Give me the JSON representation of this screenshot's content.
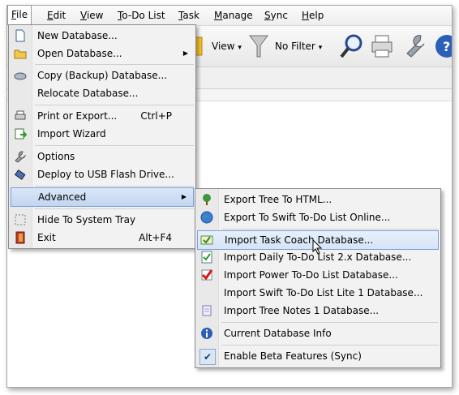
{
  "menubar": {
    "items": [
      {
        "label": "File",
        "u": "F"
      },
      {
        "label": "Edit",
        "u": "E"
      },
      {
        "label": "View",
        "u": "V"
      },
      {
        "label": "To-Do List",
        "u": "T"
      },
      {
        "label": "Task",
        "u": "T"
      },
      {
        "label": "Manage",
        "u": "M"
      },
      {
        "label": "Sync",
        "u": "S"
      },
      {
        "label": "Help",
        "u": "H"
      }
    ]
  },
  "toolbar": {
    "view_label": "View",
    "filter_label": "No Filter",
    "view_arrow": "▾",
    "filter_arrow": "▾"
  },
  "file_menu": {
    "new_db": "New Database...",
    "open_db": "Open Database...",
    "copy_db": "Copy (Backup) Database...",
    "relocate_db": "Relocate Database...",
    "print": "Print or Export...",
    "print_sc": "Ctrl+P",
    "import_wizard": "Import Wizard",
    "options": "Options",
    "deploy_usb": "Deploy to USB Flash Drive...",
    "advanced": "Advanced",
    "hide_tray": "Hide To System Tray",
    "exit": "Exit",
    "exit_sc": "Alt+F4",
    "arrow": "▶"
  },
  "advanced_menu": {
    "export_html": "Export Tree To HTML...",
    "export_online": "Export To Swift To-Do List Online...",
    "import_taskcoach": "Import Task Coach Database...",
    "import_daily": "Import Daily To-Do List 2.x Database...",
    "import_power": "Import Power To-Do List Database...",
    "import_lite": "Import Swift To-Do List Lite 1 Database...",
    "import_treenotes": "Import Tree Notes 1 Database...",
    "current_info": "Current Database Info",
    "beta_features": "Enable Beta Features (Sync)",
    "beta_checked": "✔"
  }
}
